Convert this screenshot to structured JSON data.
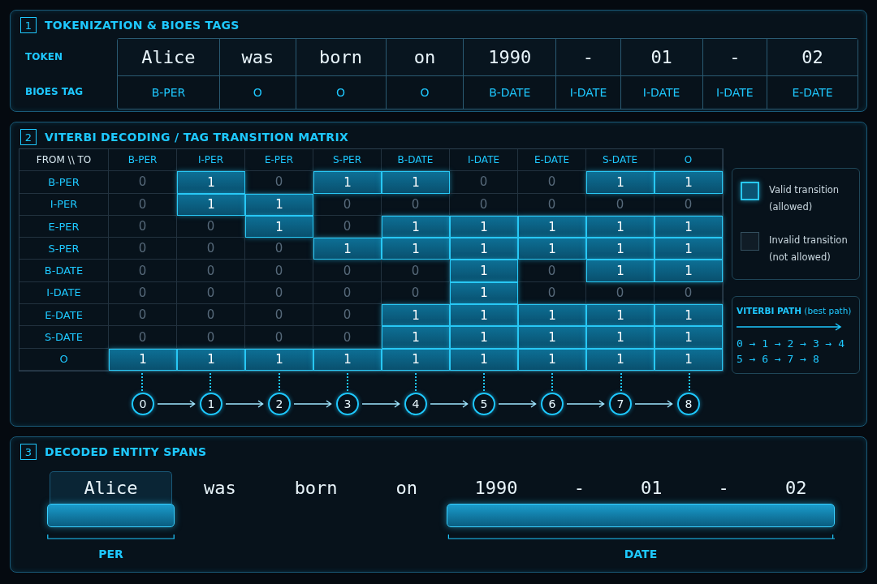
{
  "tokenization": {
    "number": "1",
    "title": "TOKENIZATION & BIOES TAGS",
    "row_labels": [
      "TOKEN",
      "BIOES TAG"
    ],
    "columns": [
      {
        "token": "Alice",
        "tag": "B-PER"
      },
      {
        "token": "was",
        "tag": "O"
      },
      {
        "token": "born",
        "tag": "O"
      },
      {
        "token": "on",
        "tag": "O"
      },
      {
        "token": "1990",
        "tag": "B-DATE"
      },
      {
        "token": "-",
        "tag": "I-DATE"
      },
      {
        "token": "01",
        "tag": "I-DATE"
      },
      {
        "token": "-",
        "tag": "I-DATE"
      },
      {
        "token": "02",
        "tag": "E-DATE"
      }
    ]
  },
  "viterbi": {
    "number": "2",
    "title": "VITERBI DECODING / TAG TRANSITION MATRIX",
    "corner": "FROM \\\\ TO",
    "to_tags": [
      "B-PER",
      "I-PER",
      "E-PER",
      "S-PER",
      "B-DATE",
      "I-DATE",
      "E-DATE",
      "S-DATE",
      "O"
    ],
    "rows": [
      {
        "from": "B-PER",
        "cells": [
          {
            "value": "0",
            "valid": false
          },
          {
            "value": "1",
            "valid": true
          },
          {
            "value": "0",
            "valid": false
          },
          {
            "value": "1",
            "valid": true
          },
          {
            "value": "1",
            "valid": true
          },
          {
            "value": "0",
            "valid": false
          },
          {
            "value": "0",
            "valid": false
          },
          {
            "value": "1",
            "valid": true
          },
          {
            "value": "1",
            "valid": true
          }
        ]
      },
      {
        "from": "I-PER",
        "cells": [
          {
            "value": "0",
            "valid": false
          },
          {
            "value": "1",
            "valid": true
          },
          {
            "value": "1",
            "valid": true
          },
          {
            "value": "0",
            "valid": false
          },
          {
            "value": "0",
            "valid": false
          },
          {
            "value": "0",
            "valid": false
          },
          {
            "value": "0",
            "valid": false
          },
          {
            "value": "0",
            "valid": false
          },
          {
            "value": "0",
            "valid": false
          }
        ]
      },
      {
        "from": "E-PER",
        "cells": [
          {
            "value": "0",
            "valid": false
          },
          {
            "value": "0",
            "valid": false
          },
          {
            "value": "1",
            "valid": true
          },
          {
            "value": "0",
            "valid": false
          },
          {
            "value": "1",
            "valid": true
          },
          {
            "value": "1",
            "valid": true
          },
          {
            "value": "1",
            "valid": true
          },
          {
            "value": "1",
            "valid": true
          },
          {
            "value": "1",
            "valid": true
          }
        ]
      },
      {
        "from": "S-PER",
        "cells": [
          {
            "value": "0",
            "valid": false
          },
          {
            "value": "0",
            "valid": false
          },
          {
            "value": "0",
            "valid": false
          },
          {
            "value": "1",
            "valid": true
          },
          {
            "value": "1",
            "valid": true
          },
          {
            "value": "1",
            "valid": true
          },
          {
            "value": "1",
            "valid": true
          },
          {
            "value": "1",
            "valid": true
          },
          {
            "value": "1",
            "valid": true
          }
        ]
      },
      {
        "from": "B-DATE",
        "cells": [
          {
            "value": "0",
            "valid": false
          },
          {
            "value": "0",
            "valid": false
          },
          {
            "value": "0",
            "valid": false
          },
          {
            "value": "0",
            "valid": false
          },
          {
            "value": "0",
            "valid": false
          },
          {
            "value": "1",
            "valid": true
          },
          {
            "value": "0",
            "valid": false
          },
          {
            "value": "1",
            "valid": true
          },
          {
            "value": "1",
            "valid": true
          }
        ]
      },
      {
        "from": "I-DATE",
        "cells": [
          {
            "value": "0",
            "valid": false
          },
          {
            "value": "0",
            "valid": false
          },
          {
            "value": "0",
            "valid": false
          },
          {
            "value": "0",
            "valid": false
          },
          {
            "value": "0",
            "valid": false
          },
          {
            "value": "1",
            "valid": true
          },
          {
            "value": "0",
            "valid": false
          },
          {
            "value": "0",
            "valid": false
          },
          {
            "value": "0",
            "valid": false
          }
        ]
      },
      {
        "from": "E-DATE",
        "cells": [
          {
            "value": "0",
            "valid": false
          },
          {
            "value": "0",
            "valid": false
          },
          {
            "value": "0",
            "valid": false
          },
          {
            "value": "0",
            "valid": false
          },
          {
            "value": "1",
            "valid": true
          },
          {
            "value": "1",
            "valid": true
          },
          {
            "value": "1",
            "valid": true
          },
          {
            "value": "1",
            "valid": true
          },
          {
            "value": "1",
            "valid": true
          }
        ]
      },
      {
        "from": "S-DATE",
        "cells": [
          {
            "value": "0",
            "valid": false
          },
          {
            "value": "0",
            "valid": false
          },
          {
            "value": "0",
            "valid": false
          },
          {
            "value": "0",
            "valid": false
          },
          {
            "value": "1",
            "valid": true
          },
          {
            "value": "1",
            "valid": true
          },
          {
            "value": "1",
            "valid": true
          },
          {
            "value": "1",
            "valid": true
          },
          {
            "value": "1",
            "valid": true
          }
        ]
      },
      {
        "from": "O",
        "cells": [
          {
            "value": "1",
            "valid": true
          },
          {
            "value": "1",
            "valid": true
          },
          {
            "value": "1",
            "valid": true
          },
          {
            "value": "1",
            "valid": true
          },
          {
            "value": "1",
            "valid": true
          },
          {
            "value": "1",
            "valid": true
          },
          {
            "value": "1",
            "valid": true
          },
          {
            "value": "1",
            "valid": true
          },
          {
            "value": "1",
            "valid": true
          }
        ]
      }
    ],
    "path_nodes": [
      "0",
      "1",
      "2",
      "3",
      "4",
      "5",
      "6",
      "7",
      "8"
    ],
    "legend": [
      {
        "label": "Valid transition (allowed)",
        "valid": true
      },
      {
        "label": "Invalid transition (not allowed)",
        "valid": false
      }
    ],
    "path_box": {
      "title": "**VITERBI PATH** (best path)",
      "lines": [
        "0 → 1 → 2 → 3 → 4",
        "5 → 6 → 7 → 8"
      ]
    }
  },
  "spans": {
    "number": "3",
    "title": "DECODED ENTITY SPANS",
    "items": [
      {
        "kind": "span",
        "label": "PER",
        "tokens": [
          {
            "text": "Alice",
            "boxed": true
          }
        ]
      },
      {
        "kind": "words",
        "tokens": [
          {
            "text": "was"
          },
          {
            "text": "born"
          },
          {
            "text": "on"
          }
        ]
      },
      {
        "kind": "span",
        "label": "DATE",
        "tokens": [
          {
            "text": "1990",
            "boxed": false
          },
          {
            "text": "-",
            "boxed": false
          },
          {
            "text": "01",
            "boxed": false
          },
          {
            "text": "-",
            "boxed": false
          },
          {
            "text": "02",
            "boxed": false
          }
        ]
      }
    ]
  }
}
